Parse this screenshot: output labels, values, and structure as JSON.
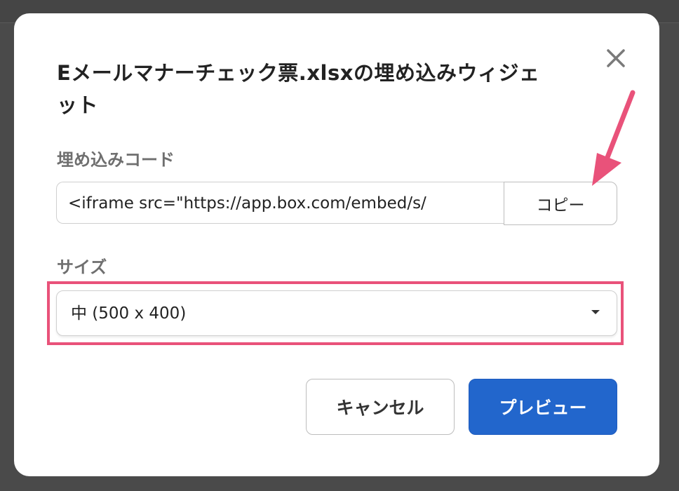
{
  "dialog": {
    "title": "Eメールマナーチェック票.xlsxの埋め込みウィジェット",
    "close_icon": "close-icon"
  },
  "embed": {
    "label": "埋め込みコード",
    "code_value": "<iframe src=\"https://app.box.com/embed/s/",
    "copy_label": "コピー"
  },
  "size": {
    "label": "サイズ",
    "selected": "中 (500 x 400)",
    "dropdown_icon": "chevron-down-icon"
  },
  "actions": {
    "cancel_label": "キャンセル",
    "preview_label": "プレビュー"
  },
  "annotations": {
    "arrow_color": "#e9527a",
    "highlight_color": "#e9527a"
  },
  "colors": {
    "primary": "#2266cc",
    "overlay": "#4a4a4a",
    "label_gray": "#6f6f6f"
  }
}
